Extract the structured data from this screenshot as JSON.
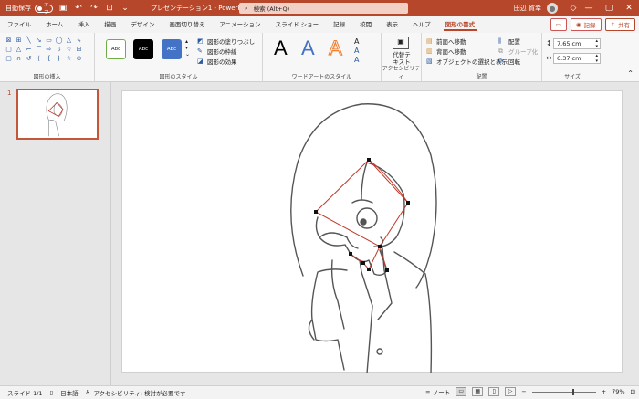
{
  "titlebar": {
    "autosave_label": "自動保存",
    "autosave_state": "オフ",
    "doc_title": "プレゼンテーション1 - PowerPoint",
    "search_placeholder": "検索 (Alt+Q)",
    "user_name": "田辺 賀幸",
    "minimize": "—",
    "maximize": "▢",
    "close": "✕"
  },
  "tabs": [
    "ファイル",
    "ホーム",
    "挿入",
    "描画",
    "デザイン",
    "画面切り替え",
    "アニメーション",
    "スライド ショー",
    "記録",
    "校閲",
    "表示",
    "ヘルプ",
    "図形の書式"
  ],
  "active_tab": "図形の書式",
  "tab_buttons": {
    "record": "記録",
    "share": "共有"
  },
  "ribbon": {
    "insert_shapes": {
      "label": "図形の挿入"
    },
    "shape_styles": {
      "label": "図形のスタイル",
      "style_samples": [
        "Abc",
        "Abc",
        "Abc"
      ],
      "fill": "図形の塗りつぶし",
      "outline": "図形の枠線",
      "effects": "図形の効果"
    },
    "wordart": {
      "label": "ワードアートのスタイル",
      "sample": "A"
    },
    "accessibility": {
      "label": "アクセシビリティ",
      "alt_text_line1": "代替テ",
      "alt_text_line2": "キスト"
    },
    "arrange": {
      "label": "配置",
      "bring_forward": "前面へ移動",
      "send_backward": "背面へ移動",
      "selection_pane": "オブジェクトの選択と表示",
      "align": "配置",
      "group": "グループ化",
      "rotate": "回転"
    },
    "size": {
      "label": "サイズ",
      "height": "7.65 cm",
      "width": "6.37 cm"
    }
  },
  "thumbnails": [
    {
      "number": "1"
    }
  ],
  "statusbar": {
    "slide": "スライド 1/1",
    "language": "日本語",
    "accessibility": "アクセシビリティ: 検討が必要です",
    "notes": "ノート",
    "zoom": "79%"
  },
  "colors": {
    "accent": "#b7472a",
    "selection": "#c0392b",
    "canvas": "#ffffff"
  }
}
